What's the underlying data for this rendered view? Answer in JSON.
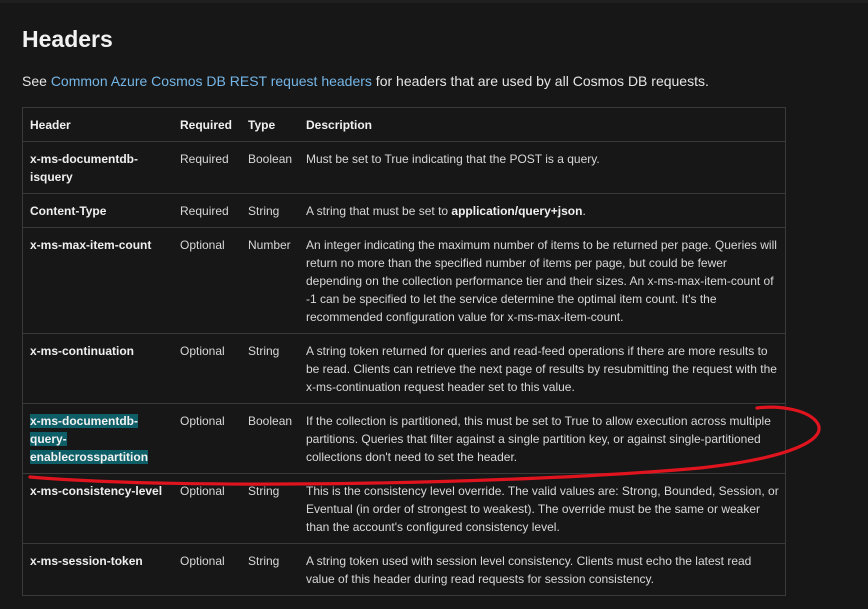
{
  "heading": "Headers",
  "intro": {
    "prefix": "See ",
    "link": "Common Azure Cosmos DB REST request headers",
    "suffix": " for headers that are used by all Cosmos DB requests."
  },
  "table": {
    "columns": [
      "Header",
      "Required",
      "Type",
      "Description"
    ],
    "rows": [
      {
        "header": "x-ms-documentdb-isquery",
        "required": "Required",
        "type": "Boolean",
        "description": "Must be set to True indicating that the POST is a query."
      },
      {
        "header": "Content-Type",
        "required": "Required",
        "type": "String",
        "description_prefix": "A string that must be set to ",
        "description_bold": "application/query+json",
        "description_suffix": "."
      },
      {
        "header": "x-ms-max-item-count",
        "required": "Optional",
        "type": "Number",
        "description": "An integer indicating the maximum number of items to be returned per page. Queries will return no more than the specified number of items per page, but could be fewer depending on the collection performance tier and their sizes. An x-ms-max-item-count of -1 can be specified to let the service determine the optimal item count. It's the recommended configuration value for x-ms-max-item-count."
      },
      {
        "header": "x-ms-continuation",
        "required": "Optional",
        "type": "String",
        "description": "A string token returned for queries and read-feed operations if there are more results to be read. Clients can retrieve the next page of results by resubmitting the request with the x-ms-continuation request header set to this value."
      },
      {
        "header_parts": [
          "x-ms-documentdb-",
          "query-",
          "enablecrosspartition"
        ],
        "required": "Optional",
        "type": "Boolean",
        "description": "If the collection is partitioned, this must be set to True to allow execution across multiple partitions. Queries that filter against a single partition key, or against single-partitioned collections don't need to set the header."
      },
      {
        "header": "x-ms-consistency-level",
        "required": "Optional",
        "type": "String",
        "description": "This is the consistency level override. The valid values are: Strong, Bounded, Session, or Eventual (in order of strongest to weakest). The override must be the same or weaker than the account's configured consistency level."
      },
      {
        "header": "x-ms-session-token",
        "required": "Optional",
        "type": "String",
        "description": "A string token used with session level consistency. Clients must echo the latest read value of this header during read requests for session consistency."
      }
    ]
  },
  "colors": {
    "background": "#171717",
    "link": "#75b6e7",
    "highlight": "#0d5e66",
    "annotation": "#e0141e"
  }
}
